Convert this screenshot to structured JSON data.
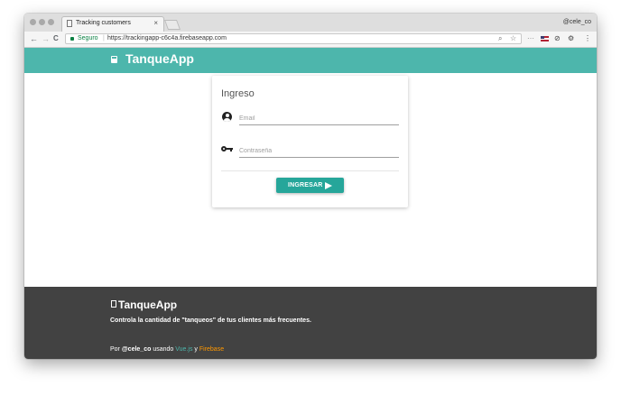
{
  "browser": {
    "tab_title": "Tracking customers",
    "tab_close": "×",
    "profile": "@cele_co",
    "address": {
      "secure_label": "Seguro",
      "separator": "|",
      "url": "https://trackingapp-c6c4a.firebaseapp.com"
    },
    "icons": [
      "back-icon",
      "forward-icon",
      "reload-icon",
      "lock-icon",
      "zoom-icon",
      "star-icon",
      "flag-icon",
      "extension-icon",
      "settings-icon",
      "menu-icon"
    ],
    "nav_glyphs": {
      "back": "←",
      "forward": "→",
      "reload": "C",
      "zoom": "⌕",
      "star": "☆",
      "ext1": "⋯",
      "ext2": "⊘",
      "gear": "⚙",
      "menu": "⋮"
    }
  },
  "app": {
    "brand": "TanqueApp",
    "accent_color": "#4db6ac",
    "button_color": "#26a69a"
  },
  "login": {
    "title": "Ingreso",
    "email_placeholder": "Email",
    "password_placeholder": "Contraseña",
    "submit_label": "INGRESAR"
  },
  "footer": {
    "brand": "TanqueApp",
    "tagline": "Controla la cantidad de \"tanqueos\" de tus clientes más frecuentes.",
    "credits_prefix": "Por",
    "credits_author": "@cele_co",
    "credits_using": "usando",
    "credits_link1": "Vue.js",
    "credits_and": "y",
    "credits_link2": "Firebase"
  }
}
